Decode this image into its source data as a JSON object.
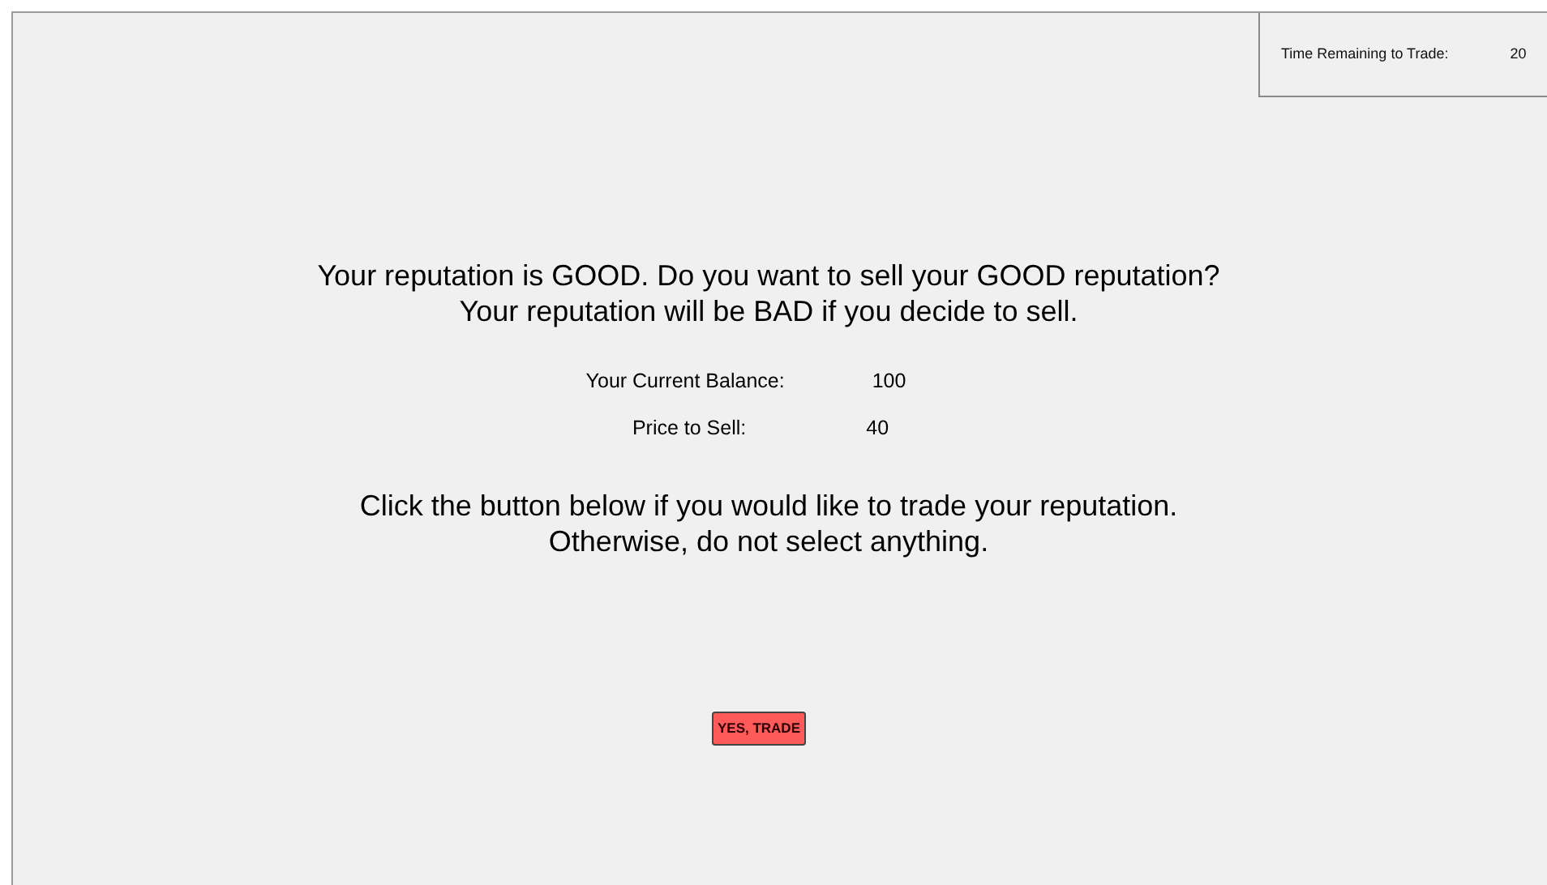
{
  "timer": {
    "label": "Time Remaining to Trade:",
    "value": "20"
  },
  "question": [
    "Your reputation is GOOD. Do you want to sell your GOOD reputation?",
    "Your reputation will be BAD if you decide to sell."
  ],
  "figures": [
    {
      "label": "Your Current Balance:",
      "value": "100"
    },
    {
      "label": "Price to Sell:",
      "value": "40"
    }
  ],
  "instruction": [
    "Click the button below if you would like to trade your reputation.",
    "Otherwise, do not select anything."
  ],
  "button": {
    "label": "YES, TRADE"
  }
}
